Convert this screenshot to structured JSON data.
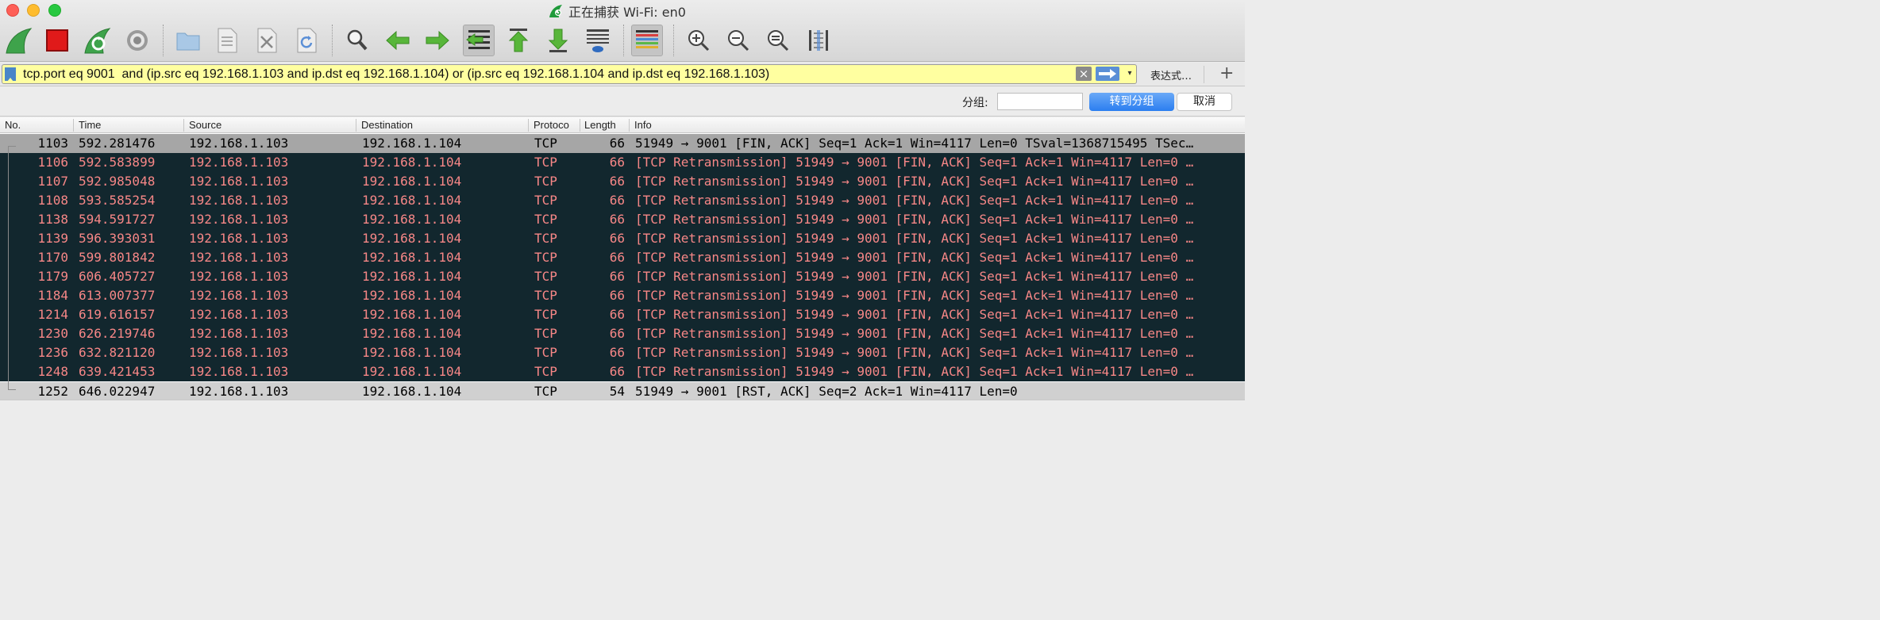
{
  "window": {
    "title": "正在捕获 Wi-Fi: en0"
  },
  "toolbar": {
    "buttons": [
      {
        "name": "start-capture-icon"
      },
      {
        "name": "stop-capture-icon"
      },
      {
        "name": "restart-capture-icon"
      },
      {
        "name": "capture-options-icon"
      },
      {
        "name": "open-file-icon"
      },
      {
        "name": "save-file-icon"
      },
      {
        "name": "close-file-icon"
      },
      {
        "name": "reload-file-icon"
      },
      {
        "name": "find-packet-icon"
      },
      {
        "name": "go-back-icon"
      },
      {
        "name": "go-forward-icon"
      },
      {
        "name": "go-to-packet-icon"
      },
      {
        "name": "go-first-packet-icon"
      },
      {
        "name": "go-last-packet-icon"
      },
      {
        "name": "auto-scroll-icon"
      },
      {
        "name": "colorize-icon"
      },
      {
        "name": "zoom-in-icon"
      },
      {
        "name": "zoom-out-icon"
      },
      {
        "name": "zoom-normal-icon"
      },
      {
        "name": "resize-columns-icon"
      }
    ]
  },
  "filter": {
    "value": "tcp.port eq 9001  and (ip.src eq 192.168.1.103 and ip.dst eq 192.168.1.104) or (ip.src eq 192.168.1.104 and ip.dst eq 192.168.1.103)",
    "expression_label": "表达式…",
    "add_label": "+",
    "clear_label": "×",
    "dropdown_label": "▾"
  },
  "goto": {
    "label": "分组:",
    "value": "",
    "go_label": "转到分组",
    "cancel_label": "取消"
  },
  "columns": {
    "no": "No.",
    "time": "Time",
    "source": "Source",
    "destination": "Destination",
    "protocol": "Protoco",
    "length": "Length",
    "info": "Info"
  },
  "packets": [
    {
      "no": "1103",
      "time": "592.281476",
      "source": "192.168.1.103",
      "destination": "192.168.1.104",
      "protocol": "TCP",
      "length": "66",
      "info": "51949 → 9001 [FIN, ACK] Seq=1 Ack=1 Win=4117 Len=0 TSval=1368715495 TSec…"
    },
    {
      "no": "1106",
      "time": "592.583899",
      "source": "192.168.1.103",
      "destination": "192.168.1.104",
      "protocol": "TCP",
      "length": "66",
      "info": "[TCP Retransmission] 51949 → 9001 [FIN, ACK] Seq=1 Ack=1 Win=4117 Len=0 …"
    },
    {
      "no": "1107",
      "time": "592.985048",
      "source": "192.168.1.103",
      "destination": "192.168.1.104",
      "protocol": "TCP",
      "length": "66",
      "info": "[TCP Retransmission] 51949 → 9001 [FIN, ACK] Seq=1 Ack=1 Win=4117 Len=0 …"
    },
    {
      "no": "1108",
      "time": "593.585254",
      "source": "192.168.1.103",
      "destination": "192.168.1.104",
      "protocol": "TCP",
      "length": "66",
      "info": "[TCP Retransmission] 51949 → 9001 [FIN, ACK] Seq=1 Ack=1 Win=4117 Len=0 …"
    },
    {
      "no": "1138",
      "time": "594.591727",
      "source": "192.168.1.103",
      "destination": "192.168.1.104",
      "protocol": "TCP",
      "length": "66",
      "info": "[TCP Retransmission] 51949 → 9001 [FIN, ACK] Seq=1 Ack=1 Win=4117 Len=0 …"
    },
    {
      "no": "1139",
      "time": "596.393031",
      "source": "192.168.1.103",
      "destination": "192.168.1.104",
      "protocol": "TCP",
      "length": "66",
      "info": "[TCP Retransmission] 51949 → 9001 [FIN, ACK] Seq=1 Ack=1 Win=4117 Len=0 …"
    },
    {
      "no": "1170",
      "time": "599.801842",
      "source": "192.168.1.103",
      "destination": "192.168.1.104",
      "protocol": "TCP",
      "length": "66",
      "info": "[TCP Retransmission] 51949 → 9001 [FIN, ACK] Seq=1 Ack=1 Win=4117 Len=0 …"
    },
    {
      "no": "1179",
      "time": "606.405727",
      "source": "192.168.1.103",
      "destination": "192.168.1.104",
      "protocol": "TCP",
      "length": "66",
      "info": "[TCP Retransmission] 51949 → 9001 [FIN, ACK] Seq=1 Ack=1 Win=4117 Len=0 …"
    },
    {
      "no": "1184",
      "time": "613.007377",
      "source": "192.168.1.103",
      "destination": "192.168.1.104",
      "protocol": "TCP",
      "length": "66",
      "info": "[TCP Retransmission] 51949 → 9001 [FIN, ACK] Seq=1 Ack=1 Win=4117 Len=0 …"
    },
    {
      "no": "1214",
      "time": "619.616157",
      "source": "192.168.1.103",
      "destination": "192.168.1.104",
      "protocol": "TCP",
      "length": "66",
      "info": "[TCP Retransmission] 51949 → 9001 [FIN, ACK] Seq=1 Ack=1 Win=4117 Len=0 …"
    },
    {
      "no": "1230",
      "time": "626.219746",
      "source": "192.168.1.103",
      "destination": "192.168.1.104",
      "protocol": "TCP",
      "length": "66",
      "info": "[TCP Retransmission] 51949 → 9001 [FIN, ACK] Seq=1 Ack=1 Win=4117 Len=0 …"
    },
    {
      "no": "1236",
      "time": "632.821120",
      "source": "192.168.1.103",
      "destination": "192.168.1.104",
      "protocol": "TCP",
      "length": "66",
      "info": "[TCP Retransmission] 51949 → 9001 [FIN, ACK] Seq=1 Ack=1 Win=4117 Len=0 …"
    },
    {
      "no": "1248",
      "time": "639.421453",
      "source": "192.168.1.103",
      "destination": "192.168.1.104",
      "protocol": "TCP",
      "length": "66",
      "info": "[TCP Retransmission] 51949 → 9001 [FIN, ACK] Seq=1 Ack=1 Win=4117 Len=0 …"
    },
    {
      "no": "1252",
      "time": "646.022947",
      "source": "192.168.1.103",
      "destination": "192.168.1.104",
      "protocol": "TCP",
      "length": "54",
      "info": "51949 → 9001 [RST, ACK] Seq=2 Ack=1 Win=4117 Len=0"
    }
  ],
  "colors": {
    "retransmission_bg": "#12272e",
    "retransmission_fg": "#f78787",
    "filter_bg": "#ffffa0",
    "accent": "#2b7ef0"
  }
}
